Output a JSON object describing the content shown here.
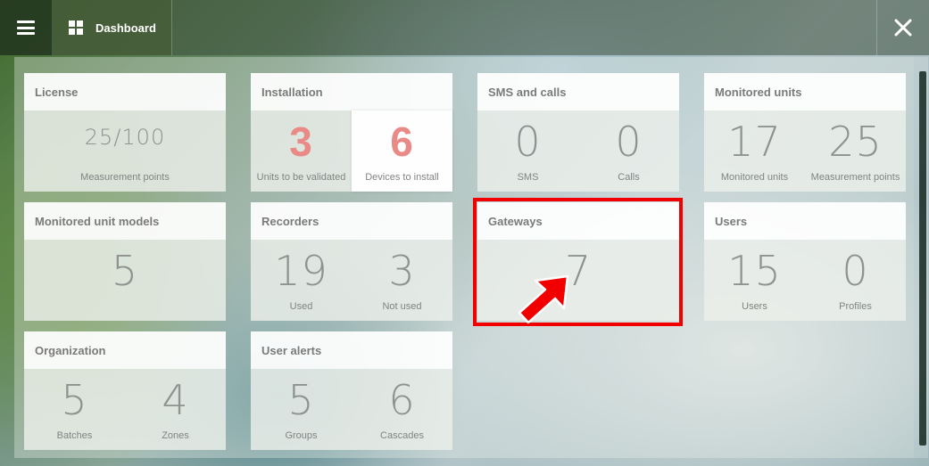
{
  "topbar": {
    "menu_icon": "hamburger-icon",
    "dashboard_icon": "grid-icon",
    "dashboard_label": "Dashboard",
    "close_icon": "close-icon"
  },
  "colors": {
    "highlight": "#f20000",
    "accent_number": "#e98a86"
  },
  "cards": {
    "license": {
      "title": "License",
      "value": "25/100",
      "label": "Measurement points"
    },
    "installation": {
      "title": "Installation",
      "a_value": "3",
      "a_label": "Units to be validated",
      "b_value": "6",
      "b_label": "Devices to install"
    },
    "sms_calls": {
      "title": "SMS and calls",
      "a_value": "0",
      "a_label": "SMS",
      "b_value": "0",
      "b_label": "Calls"
    },
    "monitored_units": {
      "title": "Monitored units",
      "a_value": "17",
      "a_label": "Monitored units",
      "b_value": "25",
      "b_label": "Measurement points"
    },
    "models": {
      "title": "Monitored unit models",
      "value": "5"
    },
    "recorders": {
      "title": "Recorders",
      "a_value": "19",
      "a_label": "Used",
      "b_value": "3",
      "b_label": "Not used"
    },
    "gateways": {
      "title": "Gateways",
      "value": "7"
    },
    "users": {
      "title": "Users",
      "a_value": "15",
      "a_label": "Users",
      "b_value": "0",
      "b_label": "Profiles"
    },
    "organization": {
      "title": "Organization",
      "a_value": "5",
      "a_label": "Batches",
      "b_value": "4",
      "b_label": "Zones"
    },
    "user_alerts": {
      "title": "User alerts",
      "a_value": "5",
      "a_label": "Groups",
      "b_value": "6",
      "b_label": "Cascades"
    }
  }
}
